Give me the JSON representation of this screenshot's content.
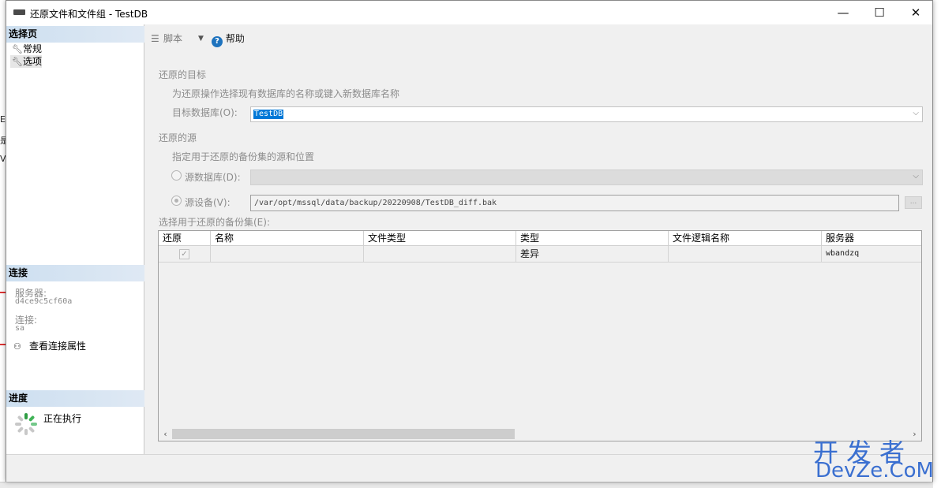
{
  "window": {
    "title": "还原文件和文件组 - TestDB",
    "minimize": "—",
    "maximize": "☐",
    "close": "✕"
  },
  "left_pane": {
    "select_page_header": "选择页",
    "pages": [
      {
        "label": "常规",
        "icon": "wrench-icon",
        "selected": false
      },
      {
        "label": "选项",
        "icon": "wrench-icon",
        "selected": true
      }
    ],
    "connection": {
      "header": "连接",
      "server_label": "服务器:",
      "server_value": "d4ce9c5cf60a",
      "connection_label": "连接:",
      "connection_value": "sa",
      "view_properties": "查看连接属性"
    },
    "progress": {
      "header": "进度",
      "status": "正在执行"
    }
  },
  "toolbar": {
    "script_label": "脚本",
    "help_label": "帮助"
  },
  "destination": {
    "section_label": "还原的目标",
    "hint": "为还原操作选择现有数据库的名称或键入新数据库名称",
    "db_label": "目标数据库(O):",
    "db_value": "TestDB"
  },
  "source": {
    "section_label": "还原的源",
    "hint": "指定用于还原的备份集的源和位置",
    "from_database_label": "源数据库(D):",
    "from_device_label": "源设备(V):",
    "device_path": "/var/opt/mssql/data/backup/20220908/TestDB_diff.bak",
    "browse": "..."
  },
  "backup_sets": {
    "label": "选择用于还原的备份集(E):",
    "columns": [
      "还原",
      "名称",
      "文件类型",
      "类型",
      "文件逻辑名称",
      "服务器"
    ],
    "rows": [
      {
        "restore": true,
        "name": "",
        "file_type": "",
        "type": "差异",
        "logical_name": "",
        "server": "wbandzq"
      }
    ]
  },
  "watermark": {
    "cn": "开发者",
    "en": "DevZe.CoM"
  },
  "colors": {
    "section_header_bg": "#cddff0",
    "selected_text_bg": "#0078d7",
    "help_icon": "#1e73be",
    "watermark": "#3a6fd0"
  }
}
